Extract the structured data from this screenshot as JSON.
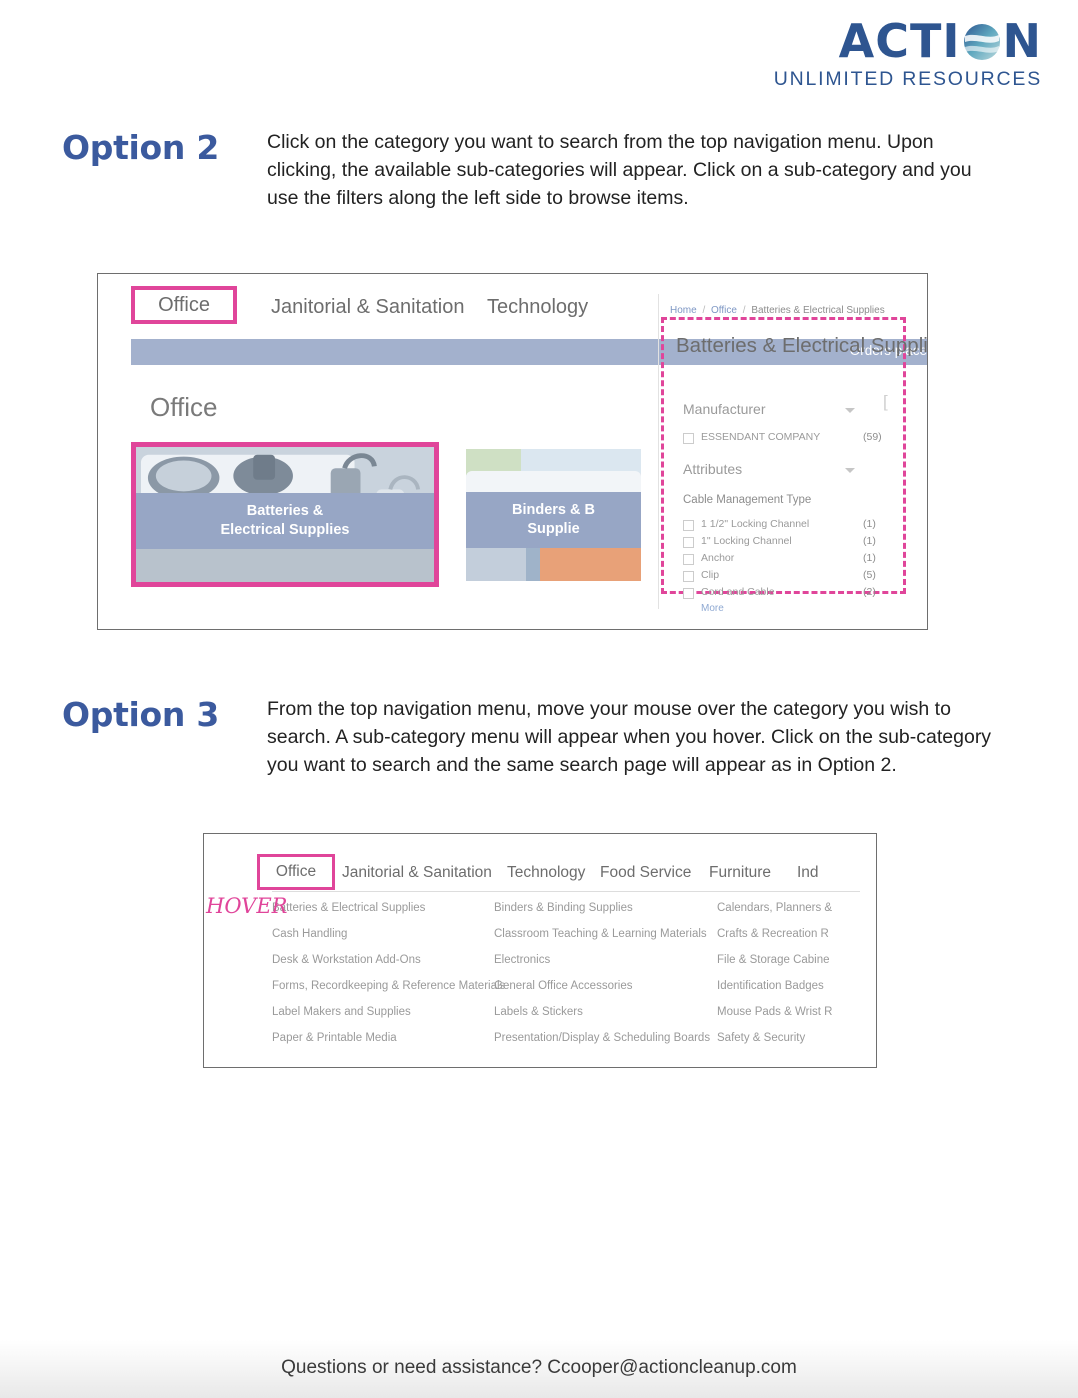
{
  "logo": {
    "main_before": "ACTI",
    "globe_icon": "globe-icon",
    "main_after": "N",
    "subtitle": "UNLIMITED RESOURCES",
    "color": "#2e5590"
  },
  "colors": {
    "heading_blue": "#3b5a9e",
    "accent_pink": "#e0459a",
    "banner_blue": "#a3b1cd",
    "caption_blue": "#97a6c5"
  },
  "option2": {
    "title": "Option 2",
    "body": "Click on the category you want to search from the top navigation menu. Upon clicking, the available sub-categories will appear. Click on a sub-category and you use the filters along the left side to browse items."
  },
  "option3": {
    "title": "Option 3",
    "body": "From the top navigation menu, move your mouse over the category you wish to search. A sub-category menu will appear when you hover. Click on the sub-category you want to search and the same search page will appear as in Option 2."
  },
  "screenshot_one": {
    "nav": {
      "highlighted": "Office",
      "items": [
        "Janitorial & Sanitation",
        "Technology"
      ]
    },
    "orders_banner": "Orders place",
    "page_heading": "Office",
    "tiles": [
      {
        "caption_line1": "Batteries &",
        "caption_line2": "Electrical Supplies",
        "image": "power-strip-photo"
      },
      {
        "caption_line1": "Binders & B",
        "caption_line2": "Supplie",
        "image": "binders-photo"
      }
    ],
    "breadcrumb": {
      "home": "Home",
      "category": "Office",
      "current": "Batteries & Electrical Supplies"
    },
    "filter_title": "Batteries & Electrical Supplies",
    "filter_groups": [
      {
        "label": "Manufacturer",
        "options": [
          {
            "label": "ESSENDANT COMPANY",
            "count": "(59)"
          }
        ]
      },
      {
        "label": "Attributes",
        "sub_label": "Cable Management Type",
        "options": [
          {
            "label": "1 1/2\" Locking Channel",
            "count": "(1)"
          },
          {
            "label": "1\" Locking Channel",
            "count": "(1)"
          },
          {
            "label": "Anchor",
            "count": "(1)"
          },
          {
            "label": "Clip",
            "count": "(5)"
          },
          {
            "label": "Cord and Cable",
            "count": "(2)"
          }
        ]
      }
    ],
    "more_link": "More"
  },
  "screenshot_two": {
    "hover_label": "HOVER",
    "nav": {
      "highlighted": "Office",
      "items": [
        "Janitorial & Sanitation",
        "Technology",
        "Food Service",
        "Furniture",
        "Ind"
      ]
    },
    "dropdown_columns": [
      [
        "Batteries & Electrical Supplies",
        "Cash Handling",
        "Desk & Workstation Add-Ons",
        "Forms, Recordkeeping & Reference Materials",
        "Label Makers and Supplies",
        "Paper & Printable Media"
      ],
      [
        "Binders & Binding Supplies",
        "Classroom Teaching & Learning Materials",
        "Electronics",
        "General Office Accessories",
        "Labels & Stickers",
        "Presentation/Display & Scheduling Boards"
      ],
      [
        "Calendars, Planners &",
        "Crafts & Recreation R",
        "File & Storage Cabine",
        "Identification Badges",
        "Mouse Pads & Wrist R",
        "Safety & Security"
      ]
    ]
  },
  "footer": {
    "text": "Questions or need assistance? Ccooper@actioncleanup.com"
  }
}
